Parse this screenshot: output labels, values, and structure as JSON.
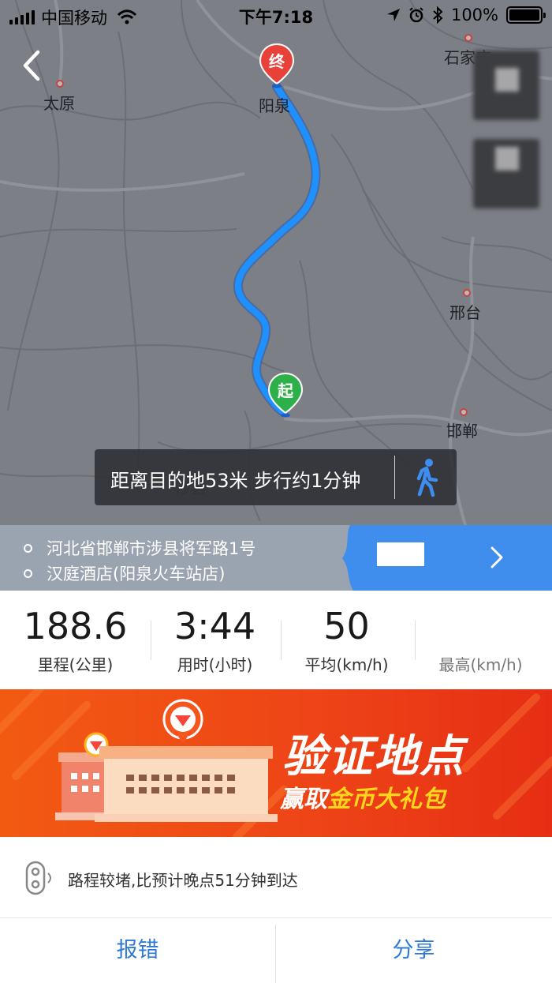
{
  "status_bar": {
    "carrier": "中国移动",
    "time": "下午7:18",
    "battery": "100%"
  },
  "map": {
    "cities": {
      "taiyuan": "太原",
      "yangquan": "阳泉",
      "shijiazhuang": "石家庄",
      "xingtai": "邢台",
      "handan": "邯郸",
      "shexian": "涉县"
    },
    "markers": {
      "end": "终",
      "start": "起"
    },
    "route_color": "#1e90ff",
    "distance_banner": "距离目的地53米 步行约1分钟"
  },
  "addresses": {
    "from": "河北省邯郸市涉县将军路1号",
    "to": "汉庭酒店(阳泉火车站店)"
  },
  "stats": [
    {
      "value": "188.6",
      "label": "里程(公里)"
    },
    {
      "value": "3:44",
      "label": "用时(小时)"
    },
    {
      "value": "50",
      "label": "平均(km/h)"
    },
    {
      "value": "",
      "label": "最高(km/h)"
    }
  ],
  "promo": {
    "title": "验证地点",
    "sub_prefix": "赢取",
    "sub_highlight": "金币大礼包"
  },
  "note": "路程较堵,比预计晚点51分钟到达",
  "actions": {
    "report": "报错",
    "share": "分享"
  }
}
